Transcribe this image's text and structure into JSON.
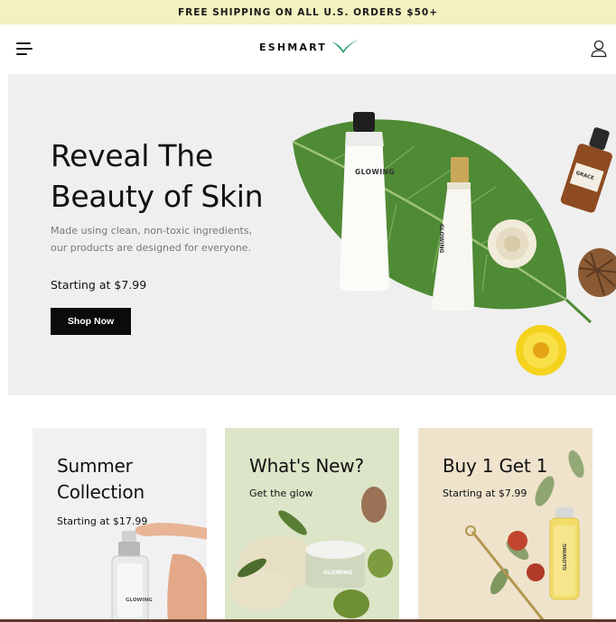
{
  "announcement": {
    "text": "FREE SHIPPING ON ALL U.S. ORDERS $50+"
  },
  "header": {
    "logo_text": "ESHMART"
  },
  "hero": {
    "title_line1": "Reveal The",
    "title_line2": "Beauty of Skin",
    "subtitle_line1": "Made using clean, non-toxic ingredients,",
    "subtitle_line2": "our products are designed for everyone.",
    "price": "Starting at $7.99",
    "cta_label": "Shop Now",
    "tube_label": "GLOWING",
    "small_tube_label": "GLOWING",
    "bottle_label": "GRACE"
  },
  "cards": [
    {
      "title_line1": "Summer",
      "title_line2": "Collection",
      "subtitle": "Starting at $17.99",
      "product_label": "GLOWING",
      "bg": "#f1f1f3"
    },
    {
      "title_line1": "What's New?",
      "subtitle": "Get the glow",
      "product_label": "GLOWING",
      "bg": "#dde5c8"
    },
    {
      "title_line1": "Buy 1 Get 1",
      "subtitle": "Starting at $7.99",
      "product_label": "GLOWING",
      "bg": "#efe3cc"
    }
  ],
  "colors": {
    "announcement_bg": "#f2f1bf",
    "button_bg": "#0b0b0b",
    "brand_accent": "#2fa36b"
  }
}
